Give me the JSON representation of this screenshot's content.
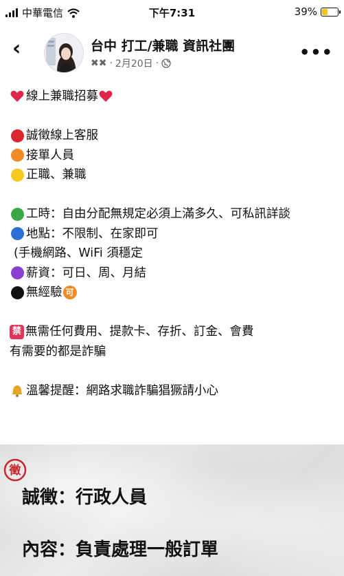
{
  "status_bar": {
    "carrier": "中華電信",
    "time": "下午7:31",
    "battery": "39%",
    "battery_level": 0.39
  },
  "header": {
    "group_name": "台中 打工/兼職 資訊社團",
    "poster": "✖✖",
    "date": "2月20日",
    "separator": "·"
  },
  "post": {
    "headline": "線上兼職招募",
    "items": {
      "recruit": "誠徵線上客服",
      "order": "接單人員",
      "type": "正職、兼職",
      "hours": "工時：自由分配無規定必須上滿多久、可私訊詳談",
      "location": "地點：不限制、在家即可",
      "location_note": "(手機網路、WiFi 須穩定",
      "salary": "薪資：可日、周、月結",
      "experience": "無經驗",
      "experience_badge": "可"
    },
    "warning_badge": "禁",
    "warning_line1": "無需任何費用、提款卡、存折、訂金、會費",
    "warning_line2": "有需要的都是詐騙",
    "reminder": "溫馨提醒：網路求職詐騙猖獗請小心"
  },
  "photo": {
    "seal_char": "徵",
    "line1": "誠徵：行政人員",
    "line2": "內容：負責處理一般訂單"
  },
  "colors": {
    "heart": "#e0264b",
    "red_dot": "#d9262f",
    "orange_dot": "#f08a24",
    "yellow_dot": "#f7c81e",
    "green_dot": "#3aa845",
    "blue_dot": "#2b6fd6",
    "purple_dot": "#8a3fd1",
    "black_dot": "#111111"
  }
}
